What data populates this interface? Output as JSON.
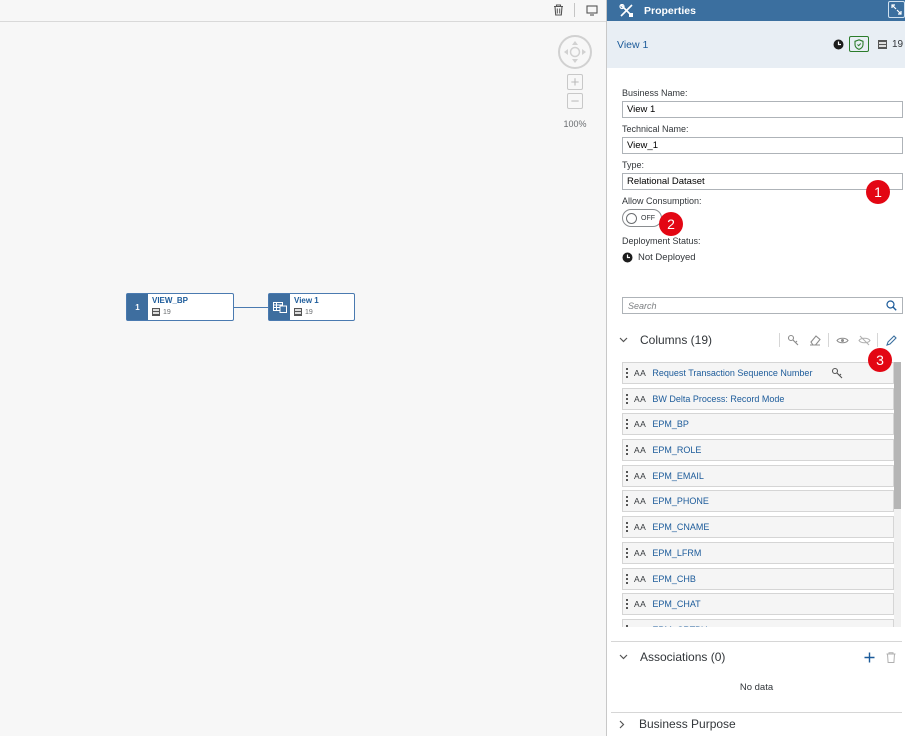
{
  "canvas": {
    "zoom_label": "100%",
    "nodes": [
      {
        "index": "1",
        "title": "VIEW_BP",
        "count": "19"
      },
      {
        "title": "View 1",
        "count": "19"
      }
    ]
  },
  "panel": {
    "header_title": "Properties",
    "object_name": "View 1",
    "object_count": "19",
    "business_name_label": "Business Name:",
    "business_name_value": "View 1",
    "technical_name_label": "Technical Name:",
    "technical_name_value": "View_1",
    "type_label": "Type:",
    "type_value": "Relational Dataset",
    "allow_consumption_label": "Allow Consumption:",
    "toggle_label": "OFF",
    "deployment_status_label": "Deployment Status:",
    "deployment_status_value": "Not Deployed",
    "search_placeholder": "Search",
    "columns_title": "Columns (19)",
    "columns": [
      {
        "type": "AA",
        "name": "Request Transaction Sequence Number"
      },
      {
        "type": "AA",
        "name": "BW Delta Process: Record Mode"
      },
      {
        "type": "AA",
        "name": "EPM_BP"
      },
      {
        "type": "AA",
        "name": "EPM_ROLE"
      },
      {
        "type": "AA",
        "name": "EPM_EMAIL"
      },
      {
        "type": "AA",
        "name": "EPM_PHONE"
      },
      {
        "type": "AA",
        "name": "EPM_CNAME"
      },
      {
        "type": "AA",
        "name": "EPM_LFRM"
      },
      {
        "type": "AA",
        "name": "EPM_CHB"
      },
      {
        "type": "AA",
        "name": "EPM_CHAT"
      },
      {
        "type": "AA",
        "name": "EPM_CRTBY"
      }
    ],
    "associations_title": "Associations (0)",
    "associations_empty": "No data",
    "business_purpose_title": "Business Purpose"
  },
  "callouts": [
    "1",
    "2",
    "3"
  ],
  "colors": {
    "header_blue": "#3b6f9f",
    "callout_red": "#e30613",
    "link_blue": "#1c5b9a"
  }
}
